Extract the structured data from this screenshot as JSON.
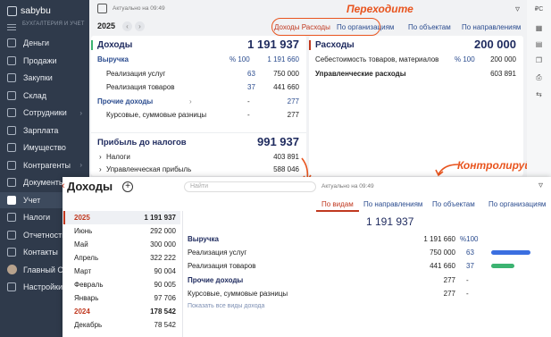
{
  "sidebar": {
    "logo": "sabybu",
    "org_label": "БУХГАЛТЕРИЯ И УЧЕТ",
    "items": [
      {
        "label": "Деньги",
        "icon": "wallet-icon"
      },
      {
        "label": "Продажи",
        "icon": "cart-icon"
      },
      {
        "label": "Закупки",
        "icon": "box-icon"
      },
      {
        "label": "Склад",
        "icon": "warehouse-icon"
      },
      {
        "label": "Сотрудники",
        "icon": "people-icon",
        "chevron": "›"
      },
      {
        "label": "Зарплата",
        "icon": "salary-icon"
      },
      {
        "label": "Имущество",
        "icon": "property-icon"
      },
      {
        "label": "Контрагенты",
        "icon": "partners-icon",
        "chevron": "›"
      },
      {
        "label": "Документы",
        "icon": "documents-icon"
      },
      {
        "label": "Учет",
        "icon": "accounting-icon",
        "active": true
      },
      {
        "label": "Налоги",
        "icon": "taxes-icon"
      },
      {
        "label": "Отчетность",
        "icon": "reports-icon"
      },
      {
        "label": "Контакты",
        "icon": "contacts-icon"
      },
      {
        "label": "Главный С.А.",
        "icon": "avatar"
      },
      {
        "label": "Настройки",
        "icon": "settings-icon"
      }
    ]
  },
  "header": {
    "updated": "Актуально на 09:49",
    "filter_icon": "filter-icon"
  },
  "year_row": {
    "year": "2025",
    "tabs": [
      "Доходы Расходы",
      "По организациям",
      "По объектам",
      "По направлениям"
    ]
  },
  "annotations": {
    "top": "Переходите",
    "bottom": "Контролируйте",
    "color": "#e8541e"
  },
  "income_card": {
    "title": "Доходы",
    "total": "1 191 937",
    "rows": [
      {
        "label": "Выручка",
        "pct": "% 100",
        "value": "1 191 660"
      },
      {
        "label": "Реализация услуг",
        "pct": "63",
        "value": "750 000"
      },
      {
        "label": "Реализация товаров",
        "pct": "37",
        "value": "441 660"
      },
      {
        "label": "Прочие доходы",
        "pct": "-",
        "value": "277"
      },
      {
        "label": "Курсовые, суммовые разницы",
        "pct": "-",
        "value": "277"
      }
    ],
    "profit": {
      "label": "Прибыль до налогов",
      "value": "991 937"
    },
    "profit_rows": [
      {
        "label": "Налоги",
        "value": "403 891"
      },
      {
        "label": "Управленческая прибыль",
        "value": "588 046"
      }
    ]
  },
  "expense_card": {
    "title": "Расходы",
    "total": "200 000",
    "rows": [
      {
        "label": "Себестоимость товаров, материалов",
        "pct": "% 100",
        "value": "200 000"
      },
      {
        "label": "Управленческие расходы",
        "pct": "",
        "value": "603 891"
      }
    ]
  },
  "popup": {
    "title": "Доходы",
    "back": "‹",
    "plus": "+",
    "search_placeholder": "Найти",
    "updated": "Актуально на 09:49",
    "tabs": [
      "По видам",
      "По направлениям",
      "По объектам",
      "По организациям"
    ],
    "periods": [
      {
        "label": "2025",
        "value": "1 191 937",
        "year": true
      },
      {
        "label": "Июнь",
        "value": "292 000"
      },
      {
        "label": "Май",
        "value": "300 000"
      },
      {
        "label": "Апрель",
        "value": "322 222"
      },
      {
        "label": "Март",
        "value": "90 004"
      },
      {
        "label": "Февраль",
        "value": "90 005"
      },
      {
        "label": "Январь",
        "value": "97 706"
      },
      {
        "label": "2024",
        "value": "178 542",
        "year": true
      },
      {
        "label": "Декабрь",
        "value": "78 542"
      }
    ],
    "total": "1 191 937",
    "rows": [
      {
        "label": "Выручка",
        "value": "1 191 660",
        "pct": "%100",
        "bold": true
      },
      {
        "label": "Реализация услуг",
        "value": "750 000",
        "pct": "63",
        "bar": 0.63,
        "color": "#3b6fe0"
      },
      {
        "label": "Реализация товаров",
        "value": "441 660",
        "pct": "37",
        "bar": 0.37,
        "color": "#3cb371"
      },
      {
        "label": "Прочие доходы",
        "value": "277",
        "pct": "-",
        "bold": true
      },
      {
        "label": "Курсовые, суммовые разницы",
        "value": "277",
        "pct": "-"
      }
    ],
    "link": "Показать все виды дохода"
  }
}
